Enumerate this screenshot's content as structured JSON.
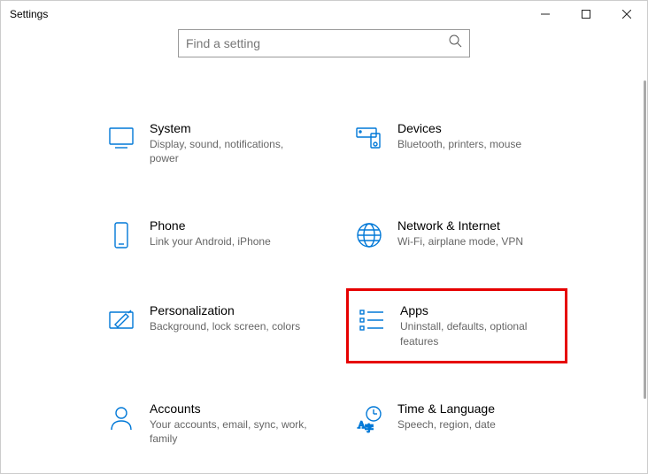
{
  "window": {
    "title": "Settings"
  },
  "search": {
    "placeholder": "Find a setting"
  },
  "tiles": {
    "system": {
      "title": "System",
      "desc": "Display, sound, notifications, power"
    },
    "devices": {
      "title": "Devices",
      "desc": "Bluetooth, printers, mouse"
    },
    "phone": {
      "title": "Phone",
      "desc": "Link your Android, iPhone"
    },
    "network": {
      "title": "Network & Internet",
      "desc": "Wi-Fi, airplane mode, VPN"
    },
    "personalization": {
      "title": "Personalization",
      "desc": "Background, lock screen, colors"
    },
    "apps": {
      "title": "Apps",
      "desc": "Uninstall, defaults, optional features"
    },
    "accounts": {
      "title": "Accounts",
      "desc": "Your accounts, email, sync, work, family"
    },
    "time": {
      "title": "Time & Language",
      "desc": "Speech, region, date"
    }
  }
}
